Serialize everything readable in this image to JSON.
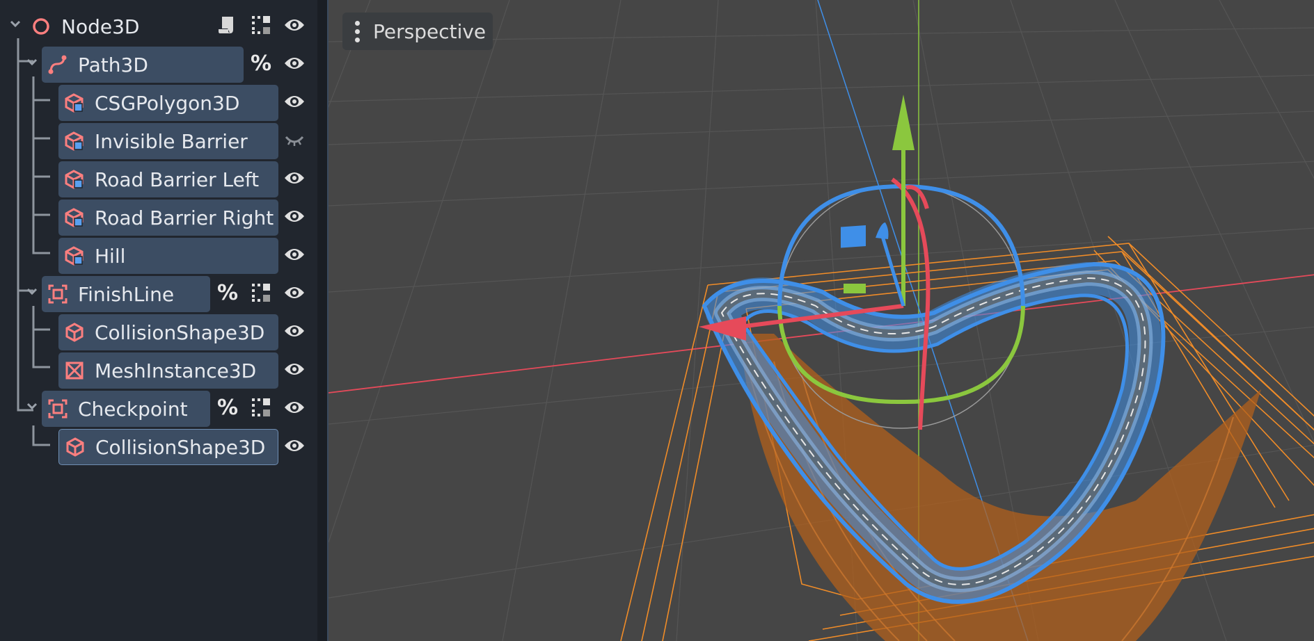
{
  "scene_tree": {
    "rows": [
      {
        "label": "Node3D",
        "icon": "node3d-icon",
        "actions": [
          "script-icon",
          "group-icon",
          "visibility-icon"
        ]
      },
      {
        "label": "Path3D",
        "icon": "path3d-icon",
        "actions": [
          "unique-name-icon",
          "visibility-icon"
        ]
      },
      {
        "label": "CSGPolygon3D",
        "icon": "csg-polygon-icon",
        "actions": [
          "visibility-icon"
        ]
      },
      {
        "label": "Invisible Barrier",
        "icon": "csg-polygon-icon",
        "actions": [
          "hidden-icon"
        ]
      },
      {
        "label": "Road Barrier Left",
        "icon": "csg-polygon-icon",
        "actions": [
          "visibility-icon"
        ]
      },
      {
        "label": "Road Barrier Right",
        "icon": "csg-polygon-icon",
        "actions": [
          "visibility-icon"
        ]
      },
      {
        "label": "Hill",
        "icon": "csg-polygon-icon",
        "actions": [
          "visibility-icon"
        ]
      },
      {
        "label": "FinishLine",
        "icon": "area3d-icon",
        "actions": [
          "unique-name-icon",
          "group-icon",
          "visibility-icon"
        ]
      },
      {
        "label": "CollisionShape3D",
        "icon": "collision-shape-icon",
        "actions": [
          "visibility-icon"
        ]
      },
      {
        "label": "MeshInstance3D",
        "icon": "mesh-instance-icon",
        "actions": [
          "visibility-icon"
        ]
      },
      {
        "label": "Checkpoint",
        "icon": "area3d-icon",
        "actions": [
          "unique-name-icon",
          "group-icon",
          "visibility-icon"
        ]
      },
      {
        "label": "CollisionShape3D",
        "icon": "collision-shape-icon",
        "actions": [
          "visibility-icon"
        ]
      }
    ],
    "unique_name_glyph": "%"
  },
  "viewport": {
    "view_menu_label": "Perspective",
    "view_menu_icon": "kebab-menu-icon"
  },
  "colors": {
    "accent": "#3c4d63",
    "node_icon": "#fc7f7f",
    "x_axis": "#e64a5a",
    "y_axis": "#8bc73e",
    "z_axis": "#3f8fe8",
    "path_mesh": "#3f8fe8",
    "collision_wire": "#f08c28"
  }
}
